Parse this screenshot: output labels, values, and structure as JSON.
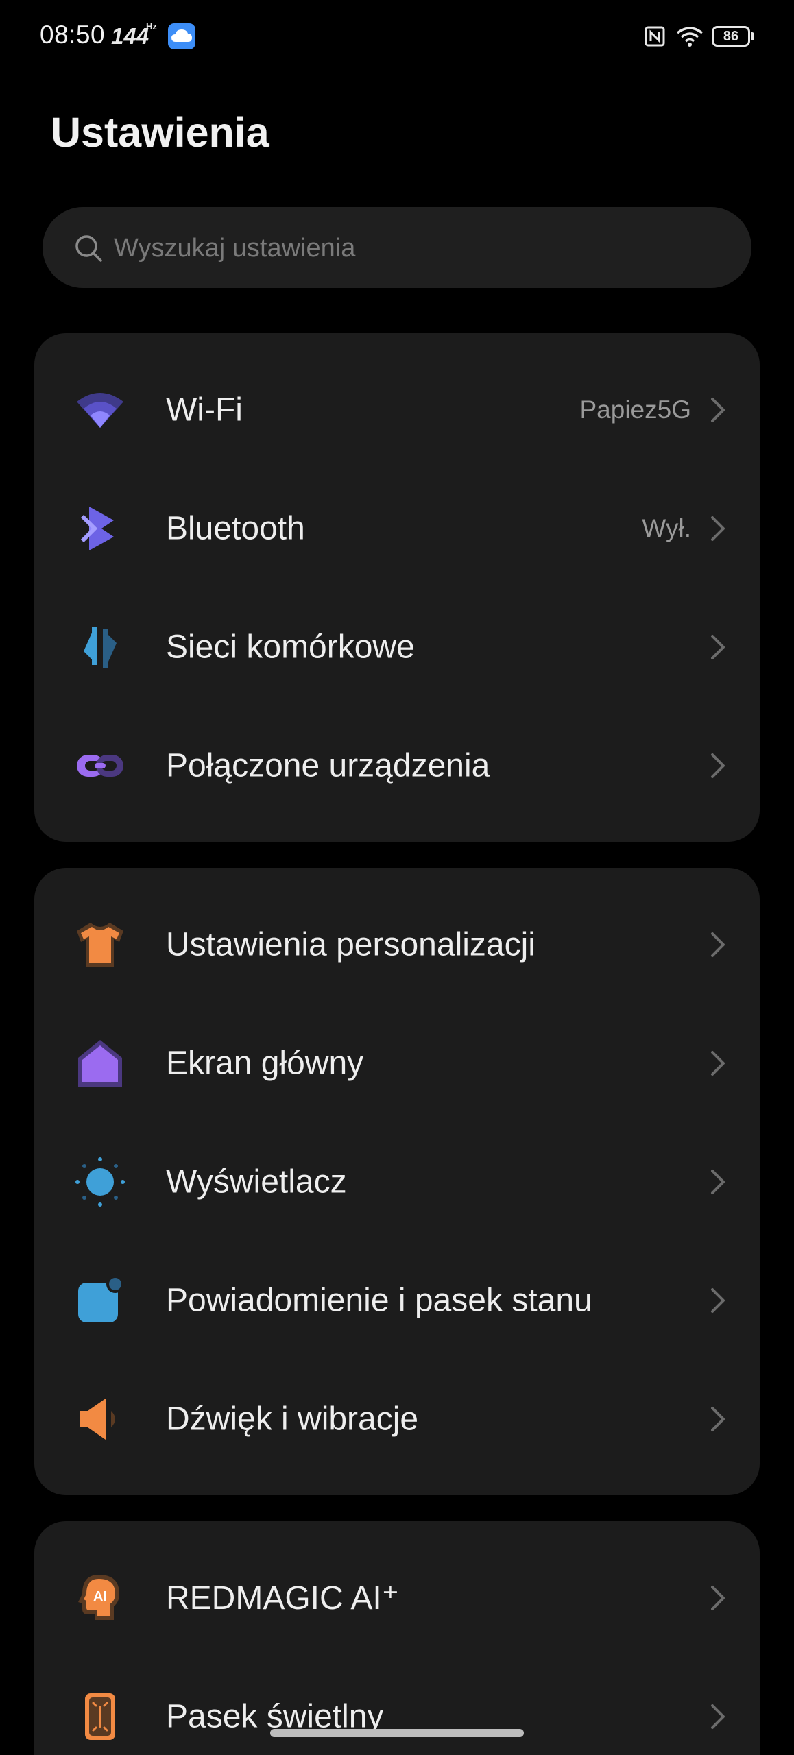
{
  "status_bar": {
    "time": "08:50",
    "refresh_rate": "144",
    "refresh_unit": "Hz",
    "battery": "86"
  },
  "header": {
    "title": "Ustawienia"
  },
  "search": {
    "placeholder": "Wyszukaj ustawienia"
  },
  "groups": [
    {
      "items": [
        {
          "label": "Wi-Fi",
          "value": "Papiez5G",
          "icon": "wifi-icon",
          "color": "#7a6cf0"
        },
        {
          "label": "Bluetooth",
          "value": "Wył.",
          "icon": "bluetooth-icon",
          "color": "#7b70f2"
        },
        {
          "label": "Sieci komórkowe",
          "value": "",
          "icon": "mobile-network-icon",
          "color": "#3fa0d8"
        },
        {
          "label": "Połączone urządzenia",
          "value": "",
          "icon": "connected-devices-icon",
          "color": "#9b6bf0"
        }
      ]
    },
    {
      "items": [
        {
          "label": "Ustawienia personalizacji",
          "value": "",
          "icon": "tshirt-icon",
          "color": "#f28a43"
        },
        {
          "label": "Ekran główny",
          "value": "",
          "icon": "home-icon",
          "color": "#9b6bf0"
        },
        {
          "label": "Wyświetlacz",
          "value": "",
          "icon": "brightness-icon",
          "color": "#3fa0d8"
        },
        {
          "label": "Powiadomienie i pasek stanu",
          "value": "",
          "icon": "notification-icon",
          "color": "#3fa0d8"
        },
        {
          "label": "Dźwięk i wibracje",
          "value": "",
          "icon": "speaker-icon",
          "color": "#f28a43"
        }
      ]
    },
    {
      "items": [
        {
          "label": "REDMAGIC AI⁺",
          "value": "",
          "icon": "ai-icon",
          "color": "#f28a43"
        },
        {
          "label": "Pasek świetlny",
          "value": "",
          "icon": "light-bar-icon",
          "color": "#f28a43"
        }
      ]
    }
  ]
}
